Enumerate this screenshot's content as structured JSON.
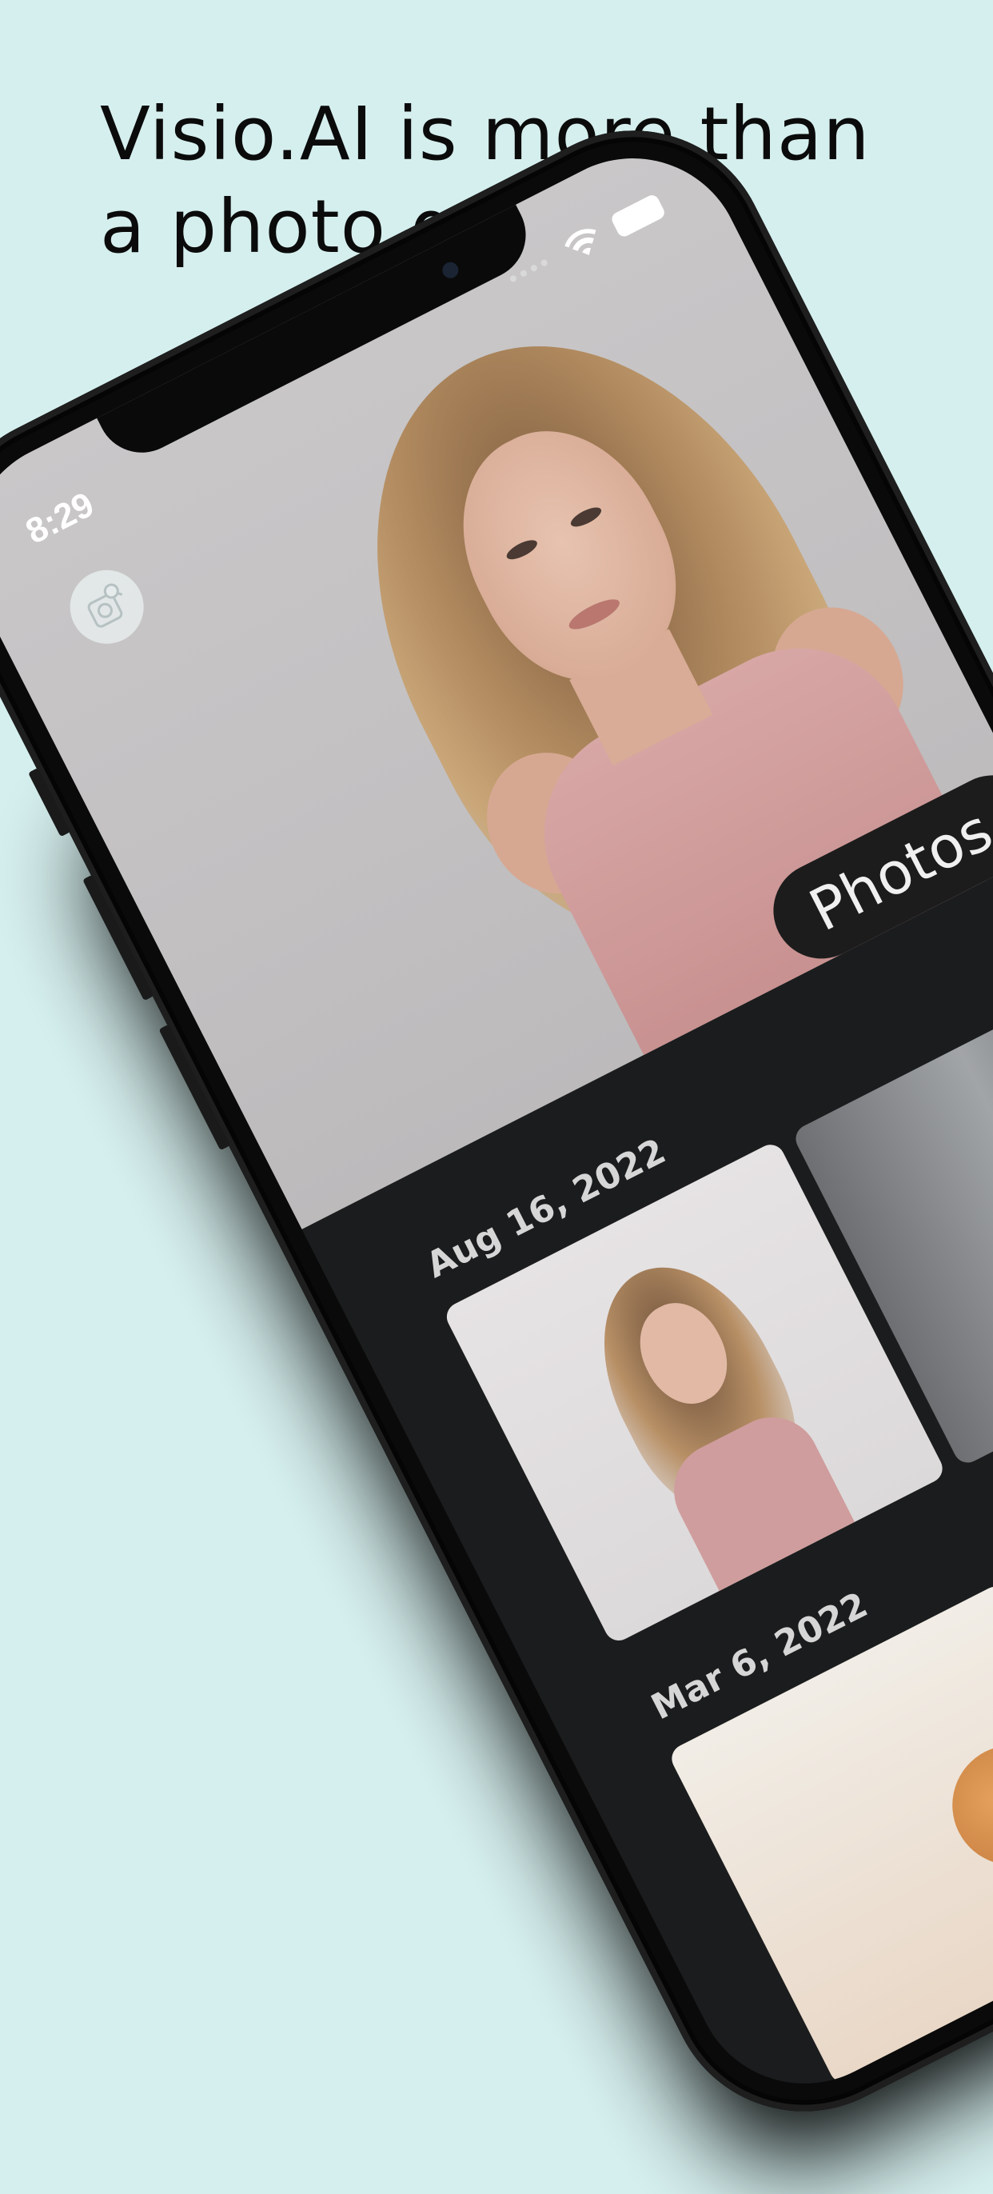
{
  "headline": {
    "line1": "Visio.AI is more than",
    "line2": "a photo gallery!"
  },
  "status_bar": {
    "time": "8:29",
    "wifi_icon": "wifi-icon",
    "battery_icon": "battery-icon"
  },
  "app": {
    "gallery_button_icon": "photo-search-icon",
    "hero_label": "Photos",
    "sections": [
      {
        "date": "Aug 16, 2022"
      },
      {
        "date": "Mar 6, 2022"
      }
    ]
  },
  "colors": {
    "background": "#d5efee",
    "headline": "#0b0b0b",
    "screen_bg": "#1b1c1d",
    "pill_bg": "#1c1c1c"
  }
}
